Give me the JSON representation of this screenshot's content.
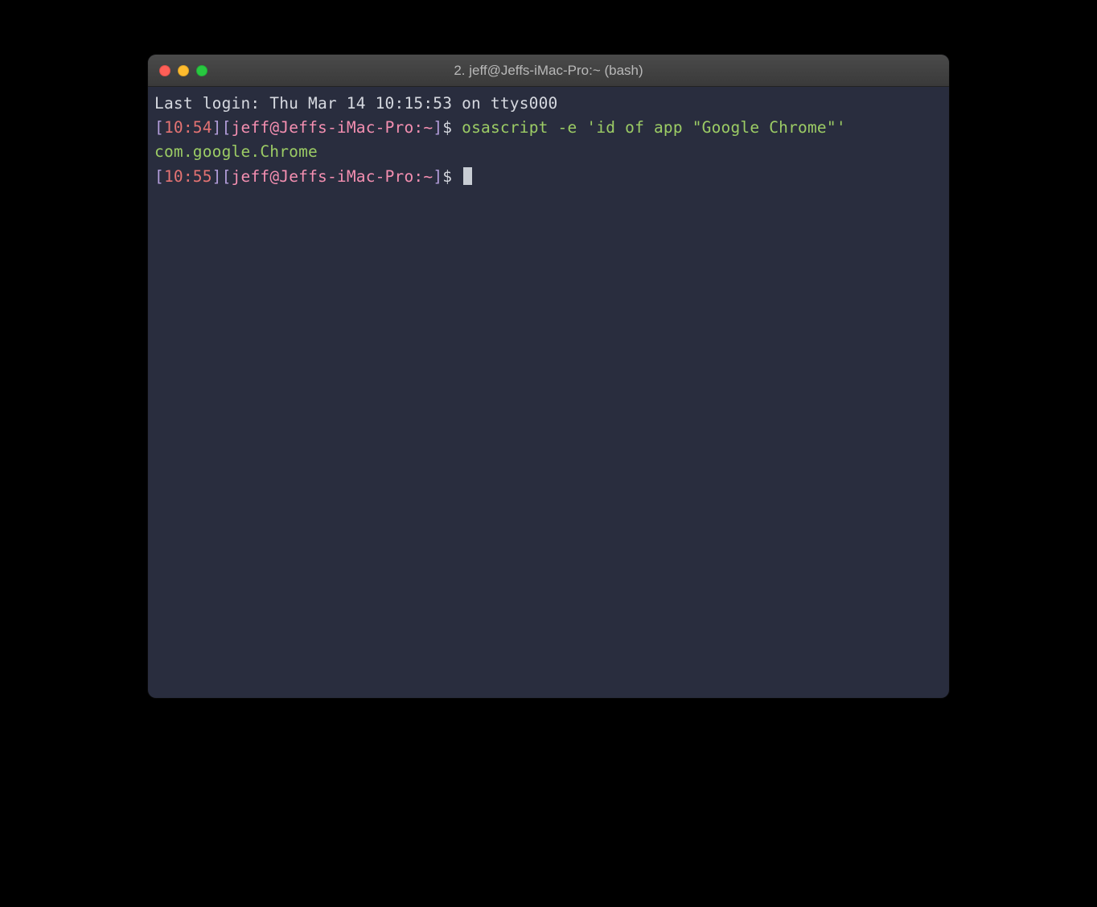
{
  "window": {
    "title": "2. jeff@Jeffs-iMac-Pro:~ (bash)"
  },
  "terminal": {
    "last_login": "Last login: Thu Mar 14 10:15:53 on ttys000",
    "line1": {
      "open1": "[",
      "time": "10:54",
      "close1": "]",
      "open2": "[",
      "userhost": "jeff@Jeffs-iMac-Pro:~",
      "close2": "]",
      "dollar": "$ ",
      "command": "osascript -e 'id of app \"Google Chrome\"'"
    },
    "output": "com.google.Chrome",
    "line2": {
      "open1": "[",
      "time": "10:55",
      "close1": "]",
      "open2": "[",
      "userhost": "jeff@Jeffs-iMac-Pro:~",
      "close2": "]",
      "dollar": "$ "
    }
  }
}
